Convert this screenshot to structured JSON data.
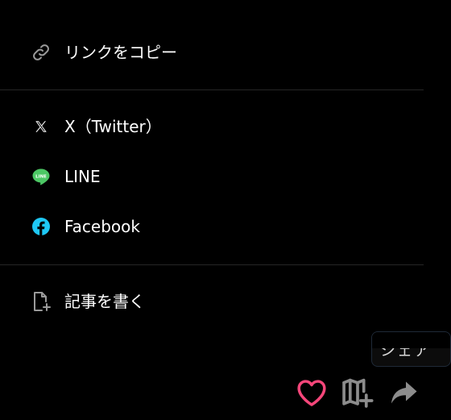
{
  "share_menu": {
    "copy_link": {
      "label": "リンクをコピー",
      "icon": "link-icon"
    },
    "twitter": {
      "label": "X（Twitter）",
      "icon": "x-logo-icon"
    },
    "line": {
      "label": "LINE",
      "icon": "line-logo-icon",
      "icon_text": "LINE",
      "color": "#4cc764"
    },
    "facebook": {
      "label": "Facebook",
      "icon": "facebook-logo-icon",
      "color": "#1ec8f5"
    },
    "write_article": {
      "label": "記事を書く",
      "icon": "new-document-icon"
    }
  },
  "tooltip": {
    "text": "シェア"
  },
  "actions": {
    "like": {
      "icon": "heart-icon",
      "color": "#f5467a"
    },
    "add_to_magazine": {
      "icon": "magazine-add-icon",
      "color": "#8c8c8c"
    },
    "share": {
      "icon": "share-arrow-icon",
      "color": "#8c8c8c"
    }
  },
  "colors": {
    "background": "#000000",
    "divider": "#262626",
    "text": "#ffffff",
    "icon_gray": "#8c8c8c"
  }
}
